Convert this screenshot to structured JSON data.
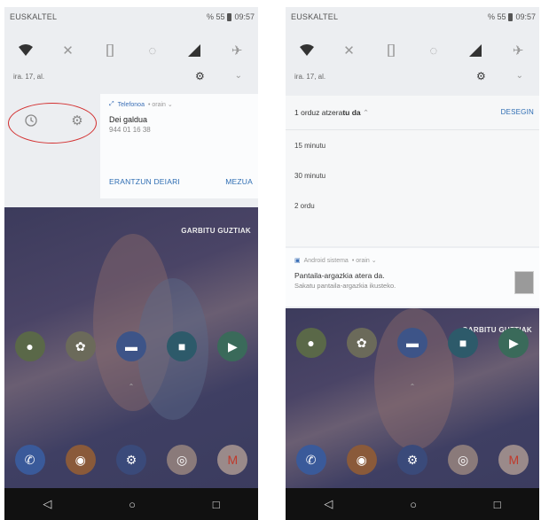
{
  "left": {
    "carrier": "EUSKALTEL",
    "battery": "% 55",
    "time": "09:57",
    "date": "ira. 17, al.",
    "notification": {
      "app": "Telefonoa",
      "meta": "• orain ⌄",
      "title": "Dei galdua",
      "subtitle": "944 01 16 38",
      "action1": "ERANTZUN DEIARI",
      "action2": "MEZUA"
    },
    "clear_all": "GARBITU GUZTIAK"
  },
  "right": {
    "carrier": "EUSKALTEL",
    "battery": "% 55",
    "time": "09:57",
    "date": "ira. 17, al.",
    "snooze": {
      "head_pre": "1 orduz atzera",
      "head_bold": "tu da",
      "head_chev": "⌃",
      "undo": "DESEGIN",
      "options": [
        "15 minutu",
        "30 minutu",
        "2 ordu"
      ]
    },
    "system_notification": {
      "app": "Android sistema",
      "meta": "• orain ⌄",
      "title": "Pantaila-argazkia atera da.",
      "subtitle": "Sakatu pantaila-argazkia ikusteko."
    },
    "clear_all": "GARBITU GUZTIAK"
  },
  "nav": {
    "back": "◁",
    "home": "○",
    "recents": "□"
  },
  "icons": {
    "wifi": "wifi-icon",
    "bluetooth": "bluetooth-off-icon",
    "flashlight": "flashlight-icon",
    "rotate": "auto-rotate-icon",
    "signal": "signal-icon",
    "airplane": "airplane-icon",
    "gear": "gear-icon",
    "chevron": "chevron-down-icon",
    "clock": "clock-icon"
  }
}
